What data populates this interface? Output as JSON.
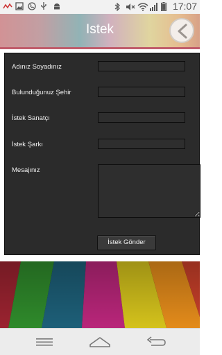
{
  "status_bar": {
    "time": "17:07",
    "icons": [
      "signal-alert-icon",
      "image-icon",
      "phone-icon",
      "usb-icon",
      "android-icon",
      "bluetooth-icon",
      "mute-icon",
      "wifi-icon",
      "cell-signal-icon",
      "battery-icon"
    ]
  },
  "header": {
    "title": "Istek",
    "back_icon": "chevron-left-icon"
  },
  "form": {
    "name_label": "Adınız Soyadınız",
    "city_label": "Bulunduğunuz Şehir",
    "artist_label": "İstek Sanatçı",
    "song_label": "İstek Şarkı",
    "message_label": "Mesajınız",
    "name_value": "",
    "city_value": "",
    "artist_value": "",
    "song_value": "",
    "message_value": "",
    "submit_label": "İstek Gönder"
  },
  "nav_bar": {
    "buttons": [
      "menu-icon",
      "home-icon",
      "back-icon"
    ]
  },
  "colors": {
    "panel_bg": "#2b2b2b",
    "accent_stripe": "#c05b6a"
  }
}
